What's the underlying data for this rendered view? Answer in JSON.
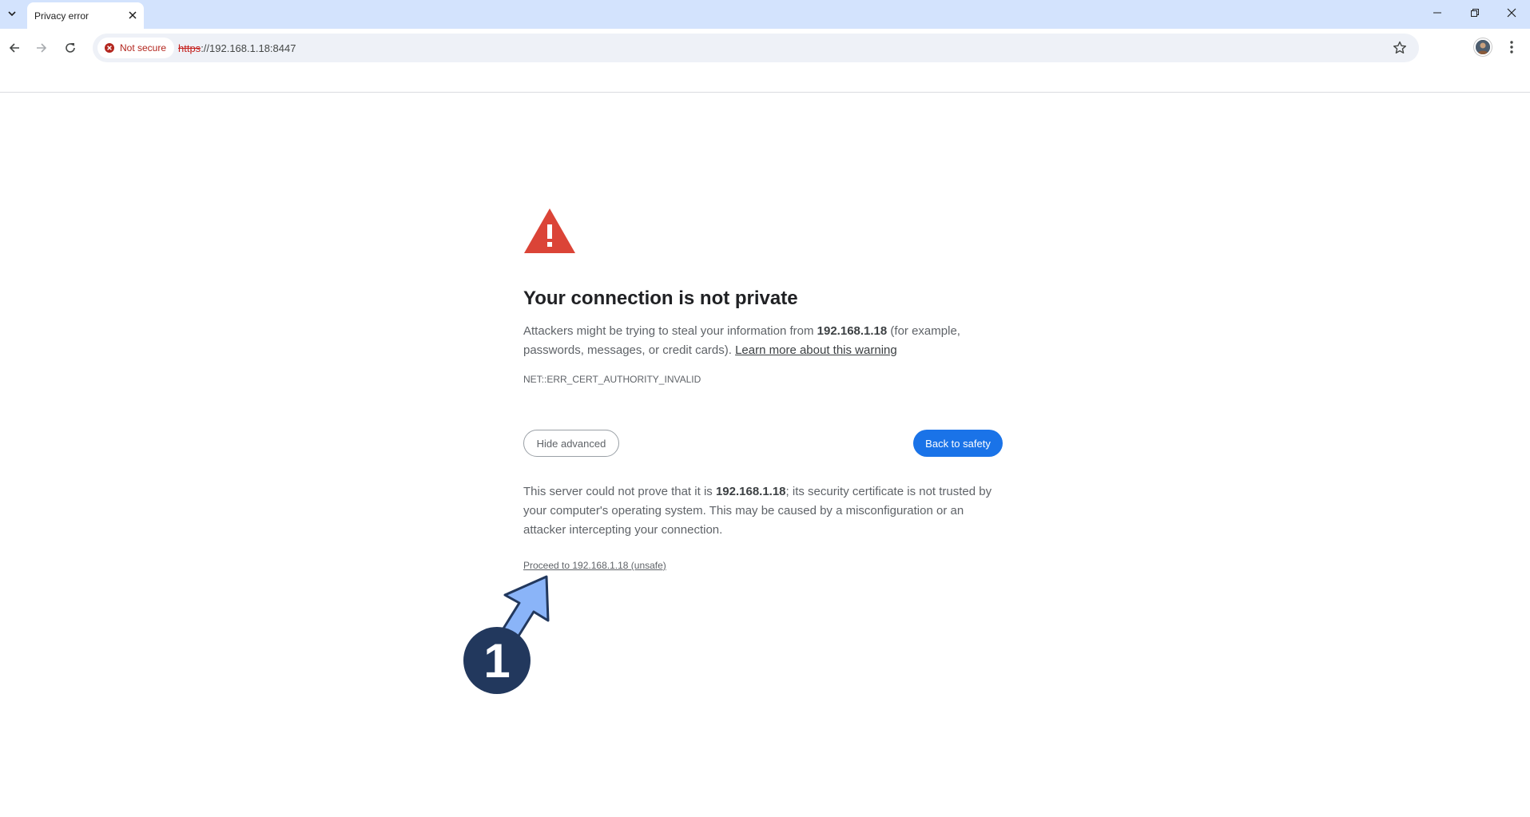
{
  "browser": {
    "tab": {
      "title": "Privacy error"
    },
    "address": {
      "security_label": "Not secure",
      "url_scheme": "https",
      "url_rest": "://192.168.1.18:8447"
    }
  },
  "page": {
    "heading": "Your connection is not private",
    "intro": {
      "before": "Attackers might be trying to steal your information from ",
      "host": "192.168.1.18",
      "after": " (for example, passwords, messages, or credit cards). ",
      "learn_more": "Learn more about this warning"
    },
    "error_code": "NET::ERR_CERT_AUTHORITY_INVALID",
    "hide_advanced_label": "Hide advanced",
    "back_to_safety_label": "Back to safety",
    "details": {
      "before": "This server could not prove that it is ",
      "host": "192.168.1.18",
      "after": "; its security certificate is not trusted by your computer's operating system. This may be caused by a misconfiguration or an attacker intercepting your connection."
    },
    "proceed_link": "Proceed to 192.168.1.18 (unsafe)"
  },
  "annotation": {
    "step_number": "1"
  },
  "colors": {
    "tabstrip": "#d3e3fd",
    "primary_button": "#1a73e8",
    "warning_red": "#db4437",
    "marker_fill": "#22385d",
    "arrow_fill": "#8ab4f8"
  }
}
